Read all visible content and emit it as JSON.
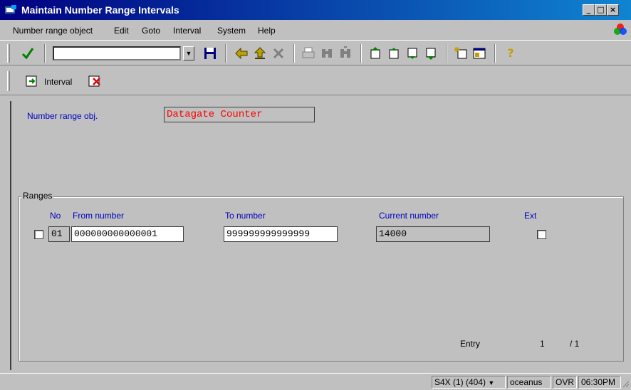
{
  "window": {
    "title": "Maintain Number Range Intervals"
  },
  "menu": [
    "Number range object",
    "Edit",
    "Goto",
    "Interval",
    "System",
    "Help"
  ],
  "toolbar": {
    "command_value": "",
    "help_glyph": "?"
  },
  "app_toolbar": {
    "interval_label": "Interval"
  },
  "header": {
    "label": "Number range obj.",
    "value": "Datagate Counter"
  },
  "ranges": {
    "title": "Ranges",
    "columns": {
      "no": "No",
      "from": "From number",
      "to": "To number",
      "current": "Current number",
      "ext": "Ext"
    },
    "rows": [
      {
        "no": "01",
        "from": "000000000000001",
        "to": "999999999999999",
        "current": "14000",
        "ext": false
      }
    ],
    "entry_label": "Entry",
    "entry_current": "1",
    "entry_total": "/ 1"
  },
  "status": {
    "system": "S4X (1) (404)",
    "server": "oceanus",
    "mode": "OVR",
    "time": "06:30PM"
  },
  "colors": {
    "title_bar": "#000080",
    "label_blue": "#0000c0",
    "highlight_red": "#ff0000",
    "face": "#c0c0c0"
  }
}
